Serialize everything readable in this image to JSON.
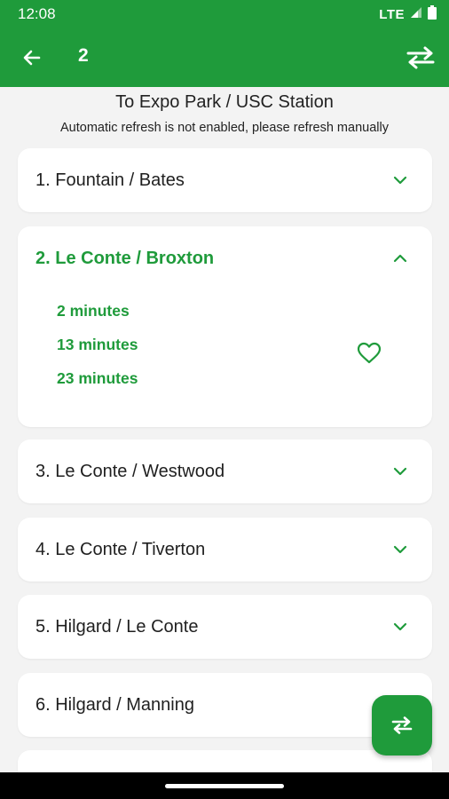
{
  "status_bar": {
    "time": "12:08",
    "network": "LTE",
    "icons": [
      "signal-icon",
      "battery-icon"
    ]
  },
  "app_bar": {
    "title": "2",
    "back_icon": "arrow-left-icon",
    "swap_icon": "swap-horizontal-icon"
  },
  "header": {
    "direction": "To Expo Park / USC Station",
    "refresh_note": "Automatic refresh is not enabled, please refresh manually"
  },
  "stops": [
    {
      "name": "1. Fountain / Bates",
      "expanded": false
    },
    {
      "name": "2. Le Conte / Broxton",
      "expanded": true,
      "arrivals": [
        "2 minutes",
        "13 minutes",
        "23 minutes"
      ]
    },
    {
      "name": "3. Le Conte / Westwood",
      "expanded": false
    },
    {
      "name": "4. Le Conte / Tiverton",
      "expanded": false
    },
    {
      "name": "5. Hilgard / Le Conte",
      "expanded": false
    },
    {
      "name": "6. Hilgard / Manning",
      "expanded": false
    }
  ],
  "colors": {
    "primary": "#1f9b3b",
    "background": "#f3f3f3",
    "card": "#ffffff"
  }
}
